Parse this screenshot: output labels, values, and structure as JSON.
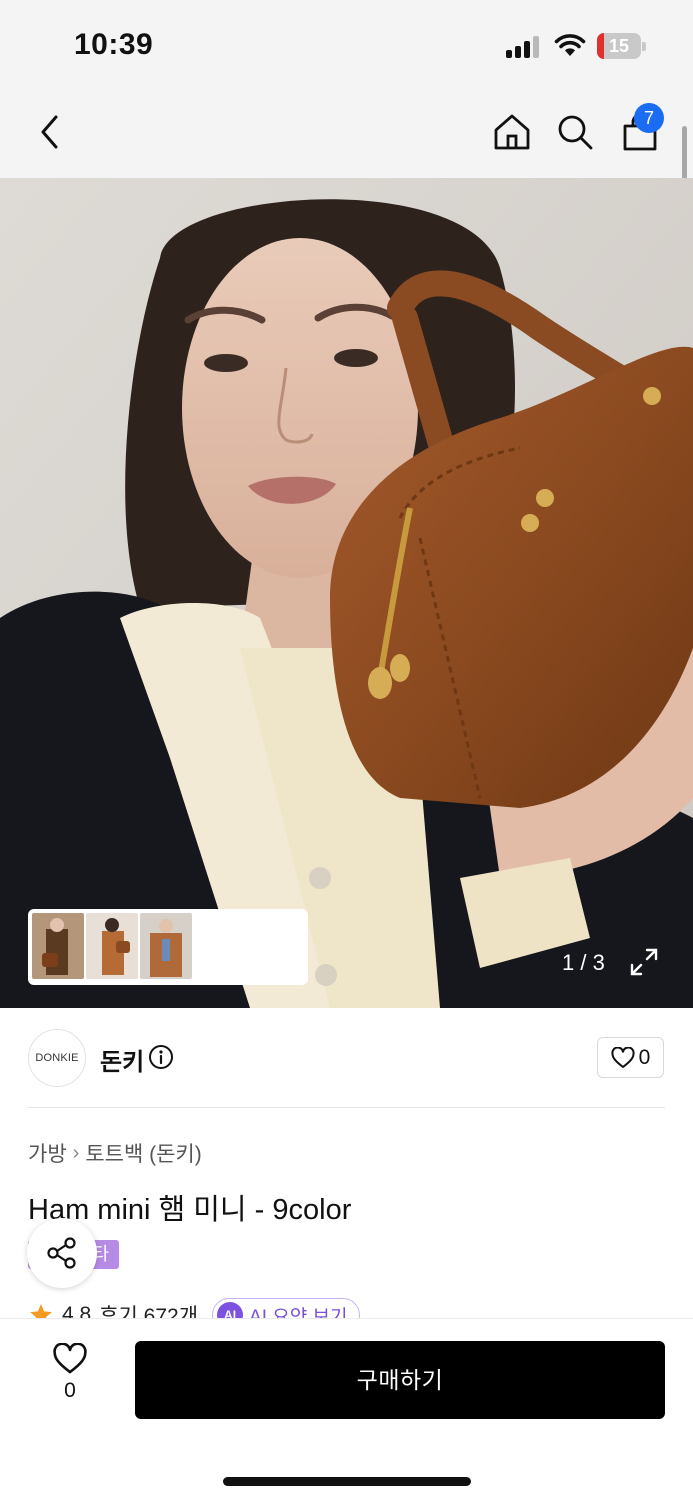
{
  "status_bar": {
    "time": "10:39",
    "battery": "15",
    "battery_level": 0.15,
    "battery_color": "#e0312f"
  },
  "nav": {
    "back_icon": "chevron-left-icon",
    "home_icon": "home-icon",
    "search_icon": "search-icon",
    "cart_icon": "shopping-bag-icon",
    "cart_count": "7",
    "badge_color": "#1a6cf2"
  },
  "hero": {
    "page_indicator": "1 / 3",
    "expand_icon": "expand-icon",
    "thumbnails": 3
  },
  "brand": {
    "logo_text": "DONKIE",
    "name": "돈키",
    "info_icon": "info-icon",
    "like_count": "0",
    "like_icon": "heart-outline-icon"
  },
  "product": {
    "breadcrumb": [
      "가방",
      "토트백 (돈키)"
    ],
    "title": "Ham mini 햄 미니 - 9color",
    "tag": "스타",
    "tag_color": "#b58be6",
    "rating": "4.8",
    "reviews": "후기 672개",
    "ai_badge": "AI",
    "ai_summary": "AI 요약 보기",
    "share_icon": "share-icon"
  },
  "bottom_bar": {
    "wish_count": "0",
    "wish_icon": "heart-outline-icon",
    "buy_label": "구매하기"
  }
}
